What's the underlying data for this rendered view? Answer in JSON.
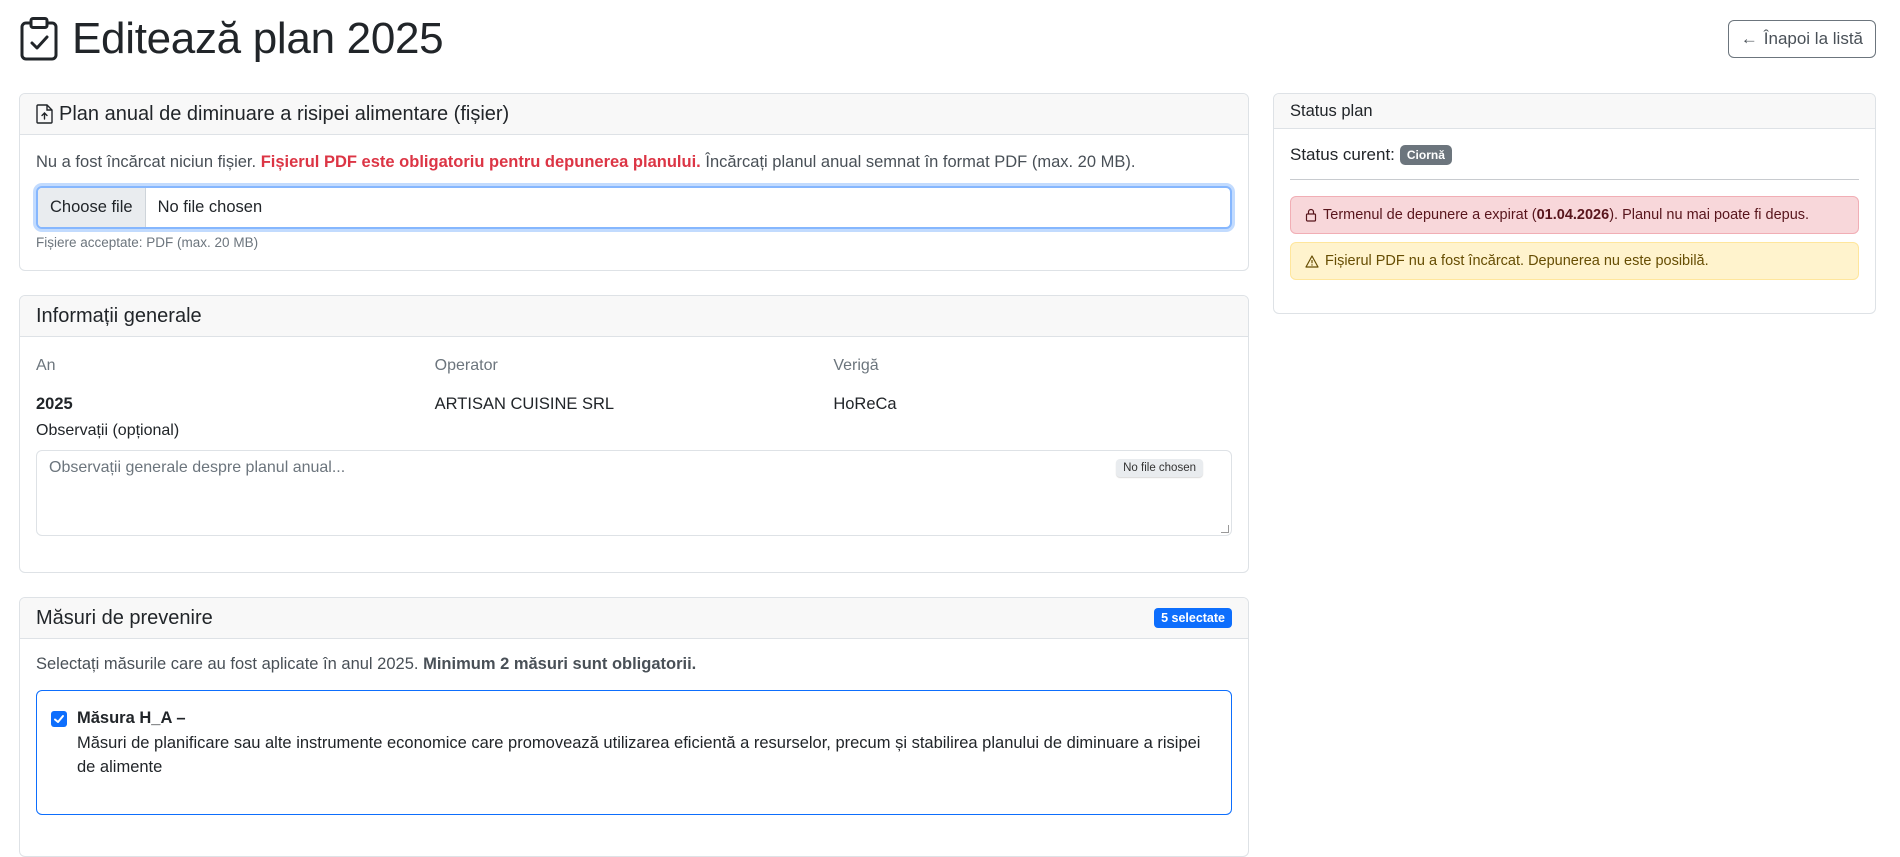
{
  "header": {
    "title": "Editează plan 2025",
    "back_label": "Înapoi la listă",
    "back_icon": "arrow-left-icon"
  },
  "upload": {
    "title": "Plan anual de diminuare a risipei alimentare (fișier)",
    "text_prefix": "Nu a fost încărcat niciun fișier.",
    "text_required": "Fișierul PDF este obligatoriu pentru depunerea planului.",
    "text_suffix": "Încărcați planul anual semnat în format PDF (max. 20 MB).",
    "choose_label": "Choose file",
    "file_status": "No file chosen",
    "help": "Fișiere acceptate: PDF (max. 20 MB)"
  },
  "info": {
    "title": "Informații generale",
    "year_label": "An",
    "year_value": "2025",
    "operator_label": "Operator",
    "operator_value": "ARTISAN CUISINE SRL",
    "chain_label": "Verigă",
    "chain_value": "HoReCa",
    "obs_label": "Observații (opțional)",
    "obs_placeholder": "Observații generale despre planul anual...",
    "obs_file_pill": "No file chosen"
  },
  "measures": {
    "title": "Măsuri de prevenire",
    "selected_badge": "5 selectate",
    "intro": "Selectați măsurile care au fost aplicate în anul 2025.",
    "intro_bold": "Minimum 2 măsuri sunt obligatorii.",
    "items": [
      {
        "title": "Măsura H_A –",
        "description": "Măsuri de planificare sau alte instrumente economice care promovează utilizarea eficientă a resurselor, precum și stabilirea planului de diminuare a risipei de alimente",
        "checked": true
      }
    ]
  },
  "status": {
    "title": "Status plan",
    "current_label": "Status curent:",
    "current_value": "Ciornă",
    "alert_deadline_prefix": "Termenul de depunere a expirat (",
    "alert_deadline_date": "01.04.2026",
    "alert_deadline_suffix": "). Planul nu mai poate fi depus.",
    "alert_pdf": "Fișierul PDF nu a fost încărcat. Depunerea nu este posibilă.",
    "colors": {
      "danger": "#dc3545",
      "warning": "#ffc107",
      "primary": "#0d6efd"
    }
  }
}
